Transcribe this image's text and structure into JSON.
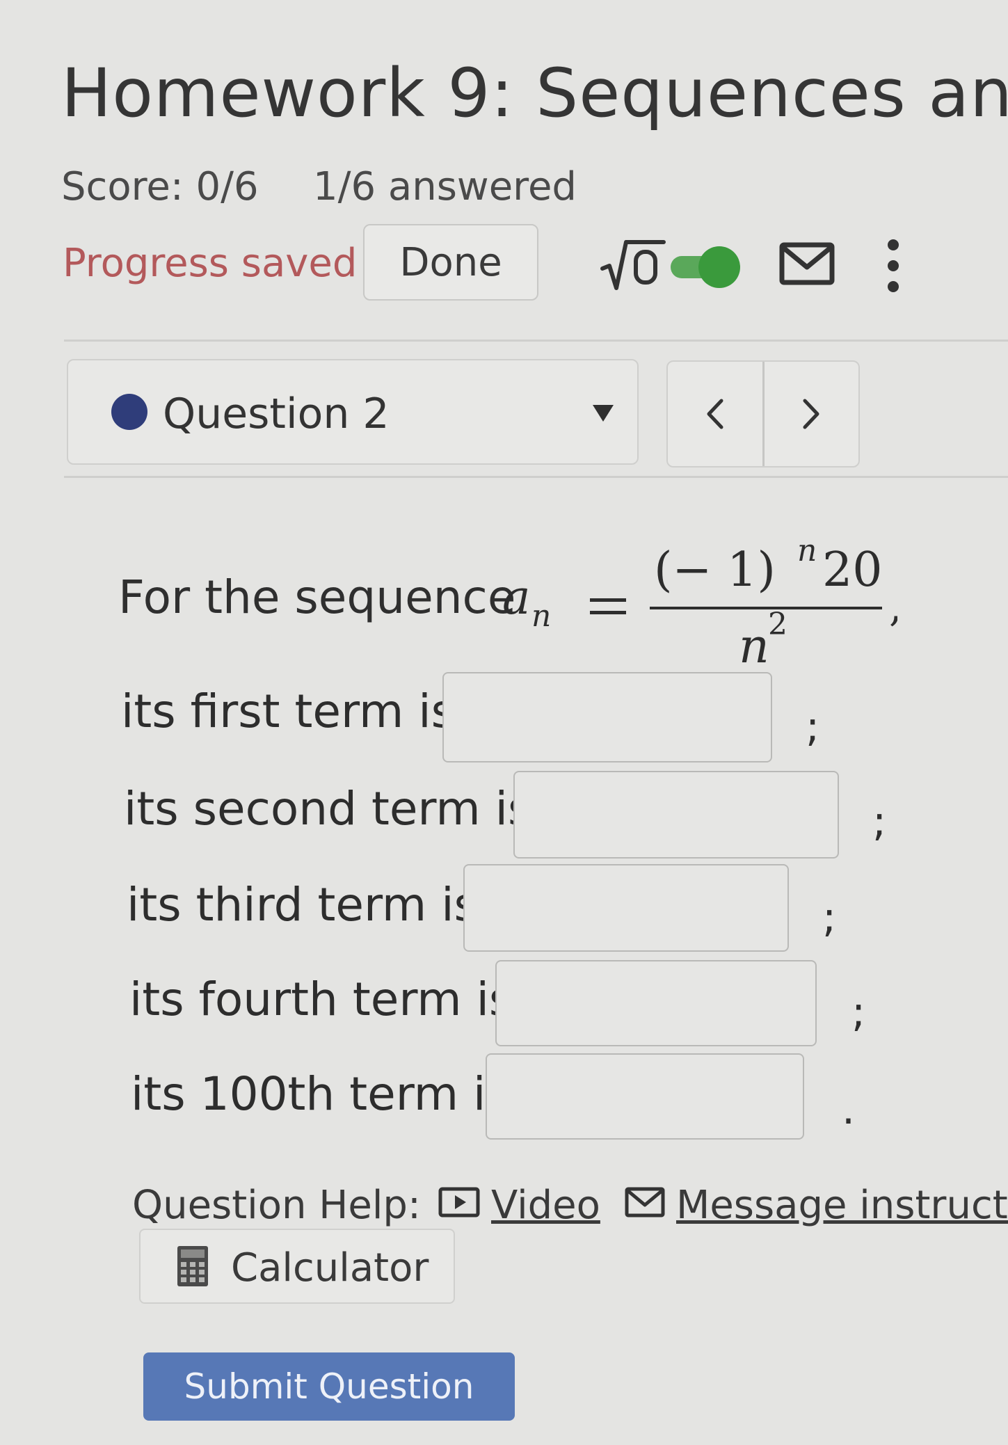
{
  "header": {
    "title": "Homework 9: Sequences an",
    "score": "Score: 0/6",
    "answered": "1/6 answered",
    "progress_status": "Progress saved",
    "done_label": "Done",
    "math_toggle_on": true
  },
  "question_nav": {
    "current": "Question 2",
    "prev_glyph": "<",
    "next_glyph": ">"
  },
  "question": {
    "prompt": "For the sequence",
    "lhs": "a",
    "lhs_sub": "n",
    "numerator_base": "(− 1)",
    "numerator_exp": "n",
    "numerator_coef": "20",
    "denominator_base": "n",
    "denominator_exp": "2",
    "trailing": ",",
    "terms": [
      {
        "label": "its first term is",
        "value": "",
        "punct": ";"
      },
      {
        "label": "its second term is",
        "value": "",
        "punct": ";"
      },
      {
        "label": "its third term is",
        "value": "",
        "punct": ";"
      },
      {
        "label": "its fourth term is",
        "value": "",
        "punct": ";"
      },
      {
        "label": "its 100th term is",
        "value": "",
        "punct": "."
      }
    ]
  },
  "help": {
    "label": "Question Help:",
    "video": "Video",
    "message": "Message instructo",
    "calculator": "Calculator"
  },
  "submit_label": "Submit Question",
  "colors": {
    "background": "#e4e4e2",
    "progress_text": "#b3595b",
    "toggle_green": "#3a9a3c",
    "question_dot": "#2f3d7a",
    "submit_bg": "#5778b6"
  }
}
